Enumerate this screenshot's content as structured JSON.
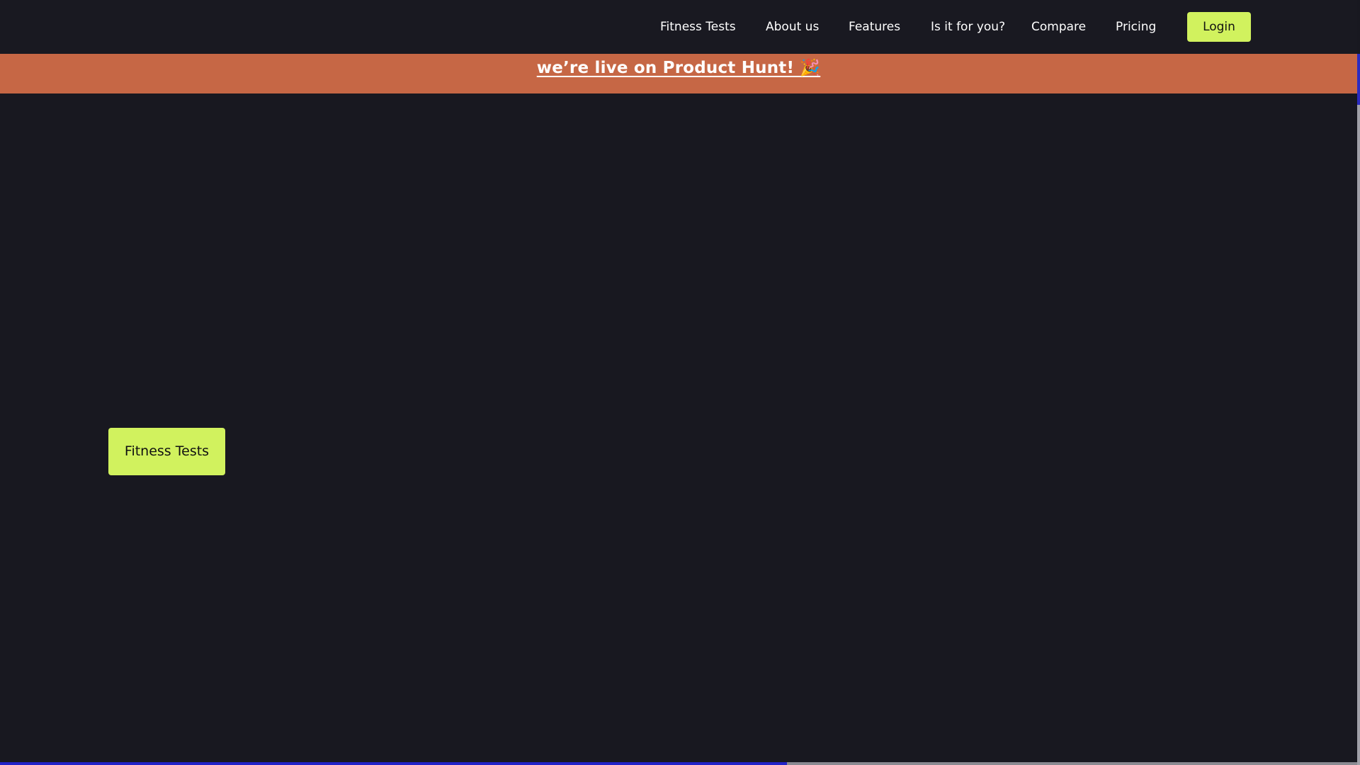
{
  "nav": {
    "items": [
      {
        "label": "Fitness Tests"
      },
      {
        "label": "About us"
      },
      {
        "label": "Features"
      },
      {
        "label": "Is it for you?"
      },
      {
        "label": "Compare"
      },
      {
        "label": "Pricing"
      }
    ],
    "login_label": "Login"
  },
  "banner": {
    "text": "we’re live on Product Hunt! 🎉"
  },
  "hero": {
    "button_label": "Fitness Tests"
  },
  "scroll": {
    "progress_fraction": 0.58
  },
  "colors": {
    "background": "#181820",
    "accent": "#d1f25e",
    "banner": "#c66745",
    "progress": "#2323c8"
  }
}
